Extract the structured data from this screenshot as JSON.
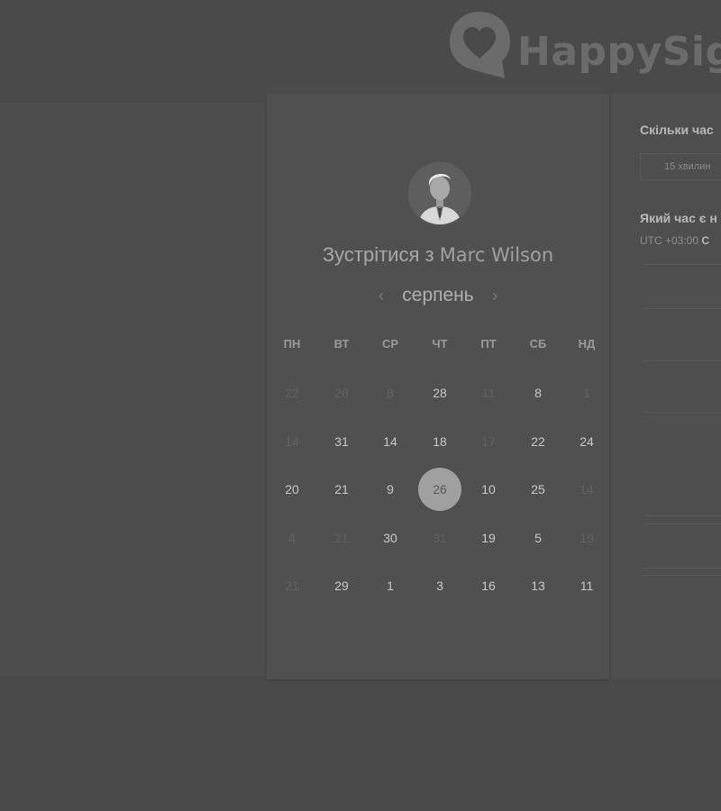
{
  "brand": {
    "name": "HappySign"
  },
  "meeting": {
    "title_prefix": "Зустрітися з",
    "host_name": "Marc Wilson"
  },
  "calendar": {
    "month": "серпень",
    "weekdays": [
      "ПН",
      "ВТ",
      "СР",
      "ЧТ",
      "ПТ",
      "СБ",
      "НД"
    ],
    "weeks": [
      [
        {
          "d": "22",
          "muted": true
        },
        {
          "d": "28",
          "muted": true
        },
        {
          "d": "8",
          "muted": true
        },
        {
          "d": "28",
          "muted": false
        },
        {
          "d": "11",
          "muted": true
        },
        {
          "d": "8",
          "muted": false
        },
        {
          "d": "1",
          "muted": true
        }
      ],
      [
        {
          "d": "14",
          "muted": true
        },
        {
          "d": "31",
          "muted": false
        },
        {
          "d": "14",
          "muted": false
        },
        {
          "d": "18",
          "muted": false
        },
        {
          "d": "17",
          "muted": true
        },
        {
          "d": "22",
          "muted": false
        },
        {
          "d": "24",
          "muted": false
        }
      ],
      [
        {
          "d": "20",
          "muted": false
        },
        {
          "d": "21",
          "muted": false
        },
        {
          "d": "9",
          "muted": false
        },
        {
          "d": "26",
          "muted": false,
          "selected": true
        },
        {
          "d": "10",
          "muted": false
        },
        {
          "d": "25",
          "muted": false
        },
        {
          "d": "14",
          "muted": true
        }
      ],
      [
        {
          "d": "4",
          "muted": true
        },
        {
          "d": "21",
          "muted": true
        },
        {
          "d": "30",
          "muted": false
        },
        {
          "d": "31",
          "muted": true
        },
        {
          "d": "19",
          "muted": false
        },
        {
          "d": "5",
          "muted": false
        },
        {
          "d": "19",
          "muted": true
        }
      ],
      [
        {
          "d": "21",
          "muted": true
        },
        {
          "d": "29",
          "muted": false
        },
        {
          "d": "1",
          "muted": false
        },
        {
          "d": "3",
          "muted": false
        },
        {
          "d": "16",
          "muted": false
        },
        {
          "d": "13",
          "muted": false
        },
        {
          "d": "11",
          "muted": false
        }
      ]
    ]
  },
  "details": {
    "duration_question": "Скільки час",
    "duration_option": "15 хвилин",
    "time_question": "Який час є н",
    "timezone_offset": "UTC +03:00",
    "timezone_city": "С"
  },
  "colors": {
    "background": "#4a4a4a",
    "panel": "#505050",
    "selected_day": "#a0a0a0"
  },
  "icons": {
    "logo": "heart-speech-bubble-icon",
    "prev": "chevron-left-icon",
    "next": "chevron-right-icon"
  }
}
